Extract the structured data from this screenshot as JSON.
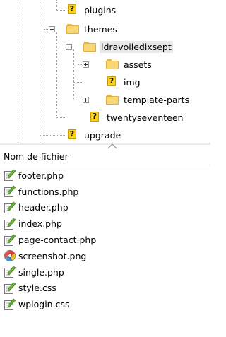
{
  "tree": {
    "items": [
      {
        "label": "plugins",
        "icon": "question-folder-icon"
      },
      {
        "label": "themes",
        "icon": "folder-icon",
        "expander": "minus"
      },
      {
        "label": "idravoiledixsept",
        "icon": "folder-icon",
        "expander": "minus",
        "selected": true
      },
      {
        "label": "assets",
        "icon": "folder-icon",
        "expander": "plus"
      },
      {
        "label": "img",
        "icon": "question-folder-icon"
      },
      {
        "label": "template-parts",
        "icon": "folder-icon",
        "expander": "plus"
      },
      {
        "label": "twentyseventeen",
        "icon": "question-folder-icon"
      },
      {
        "label": "upgrade",
        "icon": "question-folder-icon"
      }
    ]
  },
  "filelist": {
    "column_header": "Nom de fichier",
    "files": [
      {
        "name": "footer.php",
        "icon": "text-file-icon"
      },
      {
        "name": "functions.php",
        "icon": "text-file-icon"
      },
      {
        "name": "header.php",
        "icon": "text-file-icon"
      },
      {
        "name": "index.php",
        "icon": "text-file-icon"
      },
      {
        "name": "page-contact.php",
        "icon": "text-file-icon"
      },
      {
        "name": "screenshot.png",
        "icon": "image-file-icon"
      },
      {
        "name": "single.php",
        "icon": "text-file-icon"
      },
      {
        "name": "style.css",
        "icon": "text-file-icon"
      },
      {
        "name": "wplogin.css",
        "icon": "text-file-icon"
      }
    ]
  },
  "colors": {
    "folder": "#f8d775",
    "question_badge": "#ffd21a",
    "selection": "#e8e8e8"
  }
}
